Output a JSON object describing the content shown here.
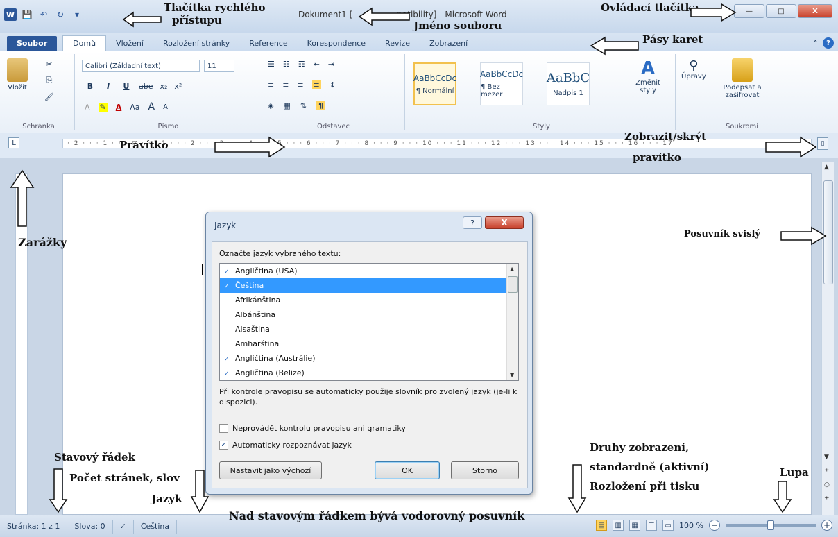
{
  "titlebar": {
    "title": "Dokument1 [Režim kompatibility] - Microsoft Word",
    "title_visible_left": "Dokument1 [",
    "title_visible_right": "patibility] - Microsoft Word",
    "qat_word": "W",
    "qat_save": "💾",
    "qat_undo": "↶",
    "qat_redo": "↻",
    "qat_more": "▾",
    "min": "—",
    "max": "□",
    "close": "X"
  },
  "tabs": {
    "file": "Soubor",
    "items": [
      "Domů",
      "Vložení",
      "Rozložení stránky",
      "Reference",
      "Korespondence",
      "Revize",
      "Zobrazení"
    ],
    "collapse": "⌃",
    "help": "?"
  },
  "ribbon": {
    "clipboard": {
      "paste": "Vložit",
      "label": "Schránka"
    },
    "font": {
      "name": "Calibri (Základní text)",
      "size": "11",
      "bold": "B",
      "italic": "I",
      "underline": "U",
      "strike": "abe",
      "sub": "x₂",
      "sup": "x²",
      "case": "Aa",
      "grow": "A",
      "shrink": "A",
      "label": "Písmo"
    },
    "paragraph": {
      "label": "Odstavec",
      "pilcrow": "¶"
    },
    "styles": {
      "items": [
        {
          "sample": "AaBbCcDc",
          "name": "¶ Normální"
        },
        {
          "sample": "AaBbCcDc",
          "name": "¶ Bez mezer"
        },
        {
          "sample": "AaBbC",
          "name": "Nadpis 1"
        }
      ],
      "change": "Změnit styly",
      "label": "Styly"
    },
    "editing": {
      "label": "Úpravy"
    },
    "privacy": {
      "sign": "Podepsat a zašifrovat",
      "label": "Soukromí"
    }
  },
  "ruler": {
    "marks": "· 2 · · · 1 · · · ▽ · · · 1 · · · 2 · · · 3 · · · 4 · · · 5 · · · 6 · · · 7 · · · 8 · · · 9 · · · 10 · · · 11 · · · 12 · · · 13 · · · 14 · · · 15 · · · 16 · · · 17",
    "tab_selector": "L"
  },
  "dialog": {
    "title": "Jazyk",
    "help": "?",
    "close": "X",
    "prompt": "Označte jazyk vybraného textu:",
    "languages": [
      {
        "name": "Angličtina (USA)",
        "spell": true,
        "selected": false
      },
      {
        "name": "Čeština",
        "spell": true,
        "selected": true
      },
      {
        "name": "Afrikánština",
        "spell": false,
        "selected": false
      },
      {
        "name": "Albánština",
        "spell": false,
        "selected": false
      },
      {
        "name": "Alsaština",
        "spell": false,
        "selected": false
      },
      {
        "name": "Amharština",
        "spell": false,
        "selected": false
      },
      {
        "name": "Angličtina (Austrálie)",
        "spell": true,
        "selected": false
      },
      {
        "name": "Angličtina (Belize)",
        "spell": true,
        "selected": false
      }
    ],
    "note": "Při kontrole pravopisu se automaticky použije slovník pro zvolený jazyk (je-li k dispozici).",
    "check_no_proof": {
      "label": "Neprovádět kontrolu pravopisu ani gramatiky",
      "checked": false
    },
    "check_auto": {
      "label": "Automaticky rozpoznávat jazyk",
      "checked": true
    },
    "set_default": "Nastavit jako výchozí",
    "ok": "OK",
    "cancel": "Storno"
  },
  "statusbar": {
    "page": "Stránka: 1 z 1",
    "words": "Slova: 0",
    "language": "Čeština",
    "zoom": "100 %",
    "zoom_minus": "−",
    "zoom_plus": "+"
  },
  "annotations": {
    "qat": "Tlačítka rychlého",
    "qat2": "přístupu",
    "filename": "Jméno souboru",
    "controls": "Ovládací tlačítka",
    "ribbon_tabs": "Pásy karet",
    "ruler": "Pravítko",
    "ruler_toggle": "Zobrazit/skrýt",
    "ruler_toggle2": "pravítko",
    "tabs": "Zarážky",
    "vscroll": "Posuvník svislý",
    "statusbar": "Stavový řádek",
    "pages_words": "Počet stránek, slov",
    "language": "Jazyk",
    "hscroll": "Nad stavovým řádkem bývá vodorovný posuvník",
    "views": "Druhy zobrazení,",
    "views2": "standardně (aktivní)",
    "views3": "Rozložení při tisku",
    "zoom": "Lupa"
  },
  "colors": {
    "accent": "#2b579a",
    "selection": "#3399ff",
    "close": "#c8412b"
  }
}
